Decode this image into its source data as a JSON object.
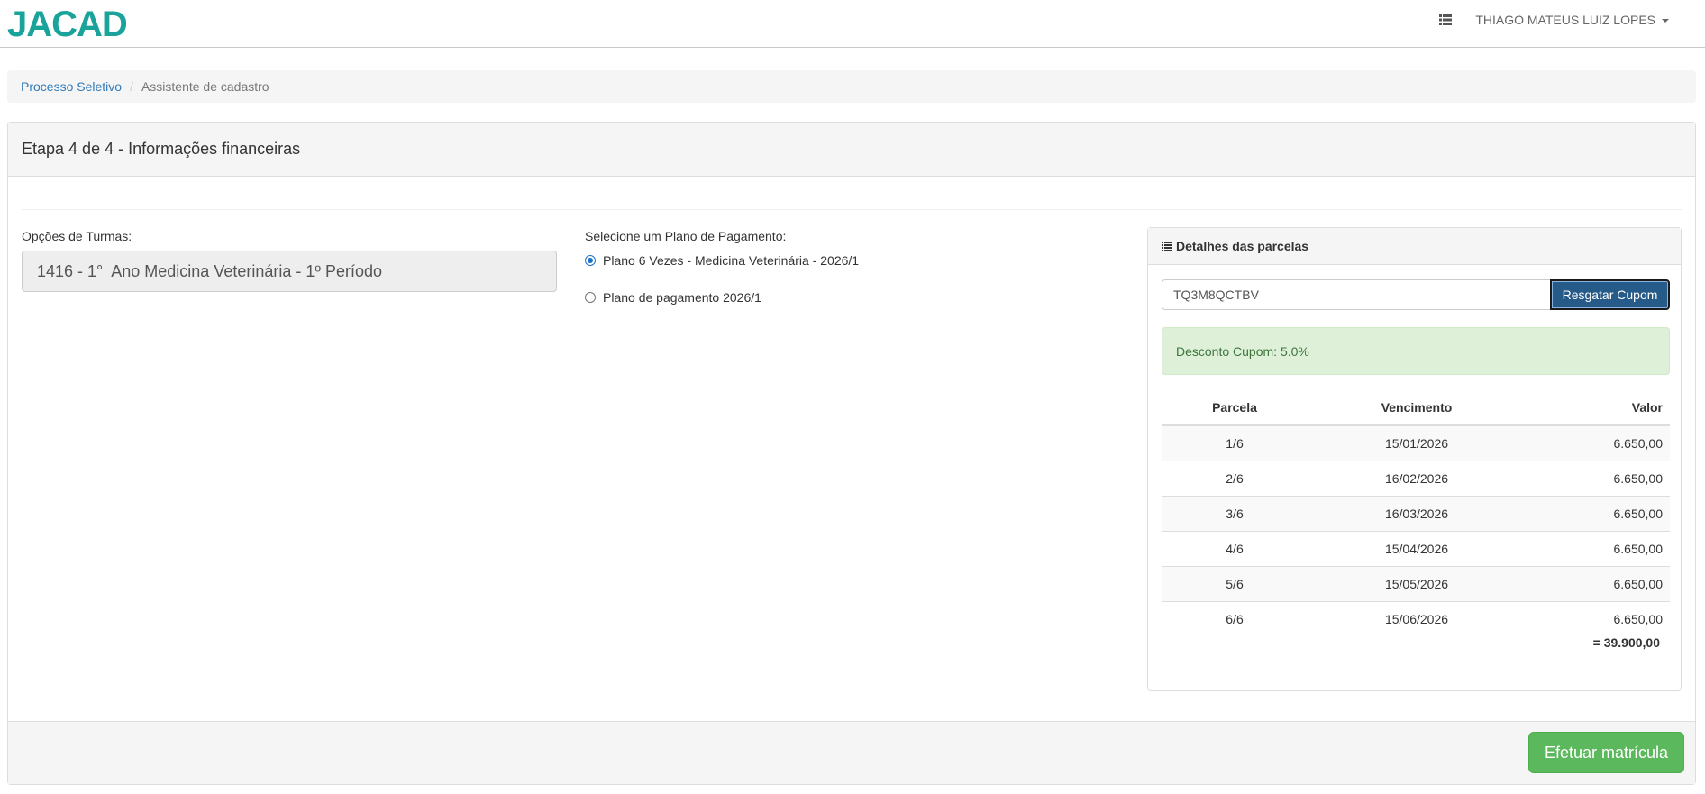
{
  "brand": {
    "logo_text": "JACAD",
    "color": "#1aa39a"
  },
  "header": {
    "user_name": "THIAGO MATEUS LUIZ LOPES",
    "menu_icon": "th-list-icon"
  },
  "breadcrumb": {
    "items": [
      "Processo Seletivo",
      "Assistente de cadastro"
    ],
    "separator": "/"
  },
  "panel": {
    "title": "Etapa 4 de 4 - Informações financeiras",
    "turmas": {
      "label": "Opções de Turmas:",
      "value": "1416 - 1°  Ano Medicina Veterinária - 1º Período"
    },
    "plano": {
      "label": "Selecione um Plano de Pagamento:",
      "options": [
        {
          "label": "Plano 6 Vezes - Medicina Veterinária - 2026/1",
          "selected": true
        },
        {
          "label": "Plano de pagamento 2026/1",
          "selected": false
        }
      ]
    },
    "details": {
      "title": "Detalhes das parcelas",
      "coupon_value": "TQ3M8QCTBV",
      "coupon_button": "Resgatar Cupom",
      "alert": "Desconto Cupom: 5.0%",
      "table": {
        "headers": [
          "Parcela",
          "Vencimento",
          "Valor"
        ],
        "rows": [
          [
            "1/6",
            "15/01/2026",
            "6.650,00"
          ],
          [
            "2/6",
            "16/02/2026",
            "6.650,00"
          ],
          [
            "3/6",
            "16/03/2026",
            "6.650,00"
          ],
          [
            "4/6",
            "15/04/2026",
            "6.650,00"
          ],
          [
            "5/6",
            "15/05/2026",
            "6.650,00"
          ],
          [
            "6/6",
            "15/06/2026",
            "6.650,00"
          ]
        ]
      },
      "total": "= 39.900,00"
    },
    "submit_button": "Efetuar matrícula"
  },
  "colors": {
    "primary": "#265a88",
    "success": "#5cb85c",
    "link": "#337ab7",
    "alert_bg": "#dff0d8",
    "alert_text": "#3c763d"
  }
}
